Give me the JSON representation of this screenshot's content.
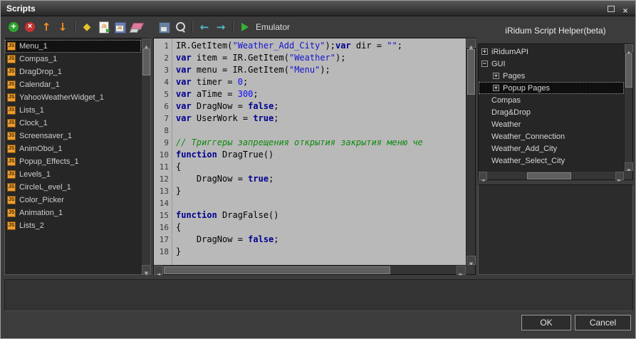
{
  "window": {
    "title": "Scripts",
    "controls": [
      "restore-window-icon",
      "close-window-icon"
    ]
  },
  "toolbar": {
    "script_actions": [
      "add-script-icon",
      "delete-script-icon",
      "move-up-icon",
      "move-down-icon",
      "syntax-check-icon",
      "import-script-icon",
      "save-script-icon",
      "erase-script-icon"
    ],
    "editor_actions": [
      "save-icon",
      "search-icon",
      "back-icon",
      "forward-icon",
      "play-icon"
    ],
    "emulator_label": "Emulator"
  },
  "script_list": {
    "badge_label": "JS",
    "selected_index": 0,
    "items": [
      "Menu_1",
      "Compas_1",
      "DragDrop_1",
      "Calendar_1",
      "YahooWeatherWidget_1",
      "Lists_1",
      "Clock_1",
      "Screensaver_1",
      "AnimOboi_1",
      "Popup_Effects_1",
      "Levels_1",
      "CircleL_evel_1",
      "Color_Picker",
      "Animation_1",
      "Lists_2"
    ]
  },
  "editor": {
    "lines": [
      {
        "n": "1",
        "t": [
          [
            "p",
            "IR.GetItem("
          ],
          [
            "s",
            "\"Weather_Add_City\""
          ],
          [
            "p",
            ");"
          ],
          [
            "k",
            "var"
          ],
          [
            "p",
            " dir = "
          ],
          [
            "s",
            "\"\""
          ],
          [
            "p",
            ";"
          ]
        ]
      },
      {
        "n": "2",
        "t": [
          [
            "k",
            "var"
          ],
          [
            "p",
            " item = IR.GetItem("
          ],
          [
            "s",
            "\"Weather\""
          ],
          [
            "p",
            ");"
          ]
        ]
      },
      {
        "n": "3",
        "t": [
          [
            "k",
            "var"
          ],
          [
            "p",
            " menu = IR.GetItem("
          ],
          [
            "s",
            "\"Menu\""
          ],
          [
            "p",
            ");"
          ]
        ]
      },
      {
        "n": "4",
        "t": [
          [
            "k",
            "var"
          ],
          [
            "p",
            " timer = "
          ],
          [
            "num",
            "0"
          ],
          [
            "p",
            ";"
          ]
        ]
      },
      {
        "n": "5",
        "t": [
          [
            "k",
            "var"
          ],
          [
            "p",
            " aTime = "
          ],
          [
            "num",
            "300"
          ],
          [
            "p",
            ";"
          ]
        ]
      },
      {
        "n": "6",
        "t": [
          [
            "k",
            "var"
          ],
          [
            "p",
            " DragNow = "
          ],
          [
            "k",
            "false"
          ],
          [
            "p",
            ";"
          ]
        ]
      },
      {
        "n": "7",
        "t": [
          [
            "k",
            "var"
          ],
          [
            "p",
            " UserWork = "
          ],
          [
            "k",
            "true"
          ],
          [
            "p",
            ";"
          ]
        ]
      },
      {
        "n": "8",
        "t": []
      },
      {
        "n": "9",
        "t": [
          [
            "c",
            "// Триггеры запрещения открытия закрытия меню че"
          ]
        ]
      },
      {
        "n": "10",
        "t": [
          [
            "k",
            "function"
          ],
          [
            "p",
            " DragTrue()"
          ]
        ]
      },
      {
        "n": "11",
        "t": [
          [
            "p",
            "{"
          ]
        ]
      },
      {
        "n": "12",
        "t": [
          [
            "p",
            "    DragNow = "
          ],
          [
            "k",
            "true"
          ],
          [
            "p",
            ";"
          ]
        ]
      },
      {
        "n": "13",
        "t": [
          [
            "p",
            "}"
          ]
        ]
      },
      {
        "n": "14",
        "t": []
      },
      {
        "n": "15",
        "t": [
          [
            "k",
            "function"
          ],
          [
            "p",
            " DragFalse()"
          ]
        ]
      },
      {
        "n": "16",
        "t": [
          [
            "p",
            "{"
          ]
        ]
      },
      {
        "n": "17",
        "t": [
          [
            "p",
            "    DragNow = "
          ],
          [
            "k",
            "false"
          ],
          [
            "p",
            ";"
          ]
        ]
      },
      {
        "n": "18",
        "t": [
          [
            "p",
            "}"
          ]
        ]
      }
    ]
  },
  "helper": {
    "title": "iRidum Script Helper(beta)",
    "items": [
      {
        "label": "iRidumAPI",
        "level": 0,
        "expander": "plus",
        "selected": false
      },
      {
        "label": "GUI",
        "level": 0,
        "expander": "minus",
        "selected": false
      },
      {
        "label": "Pages",
        "level": 1,
        "expander": "plus",
        "selected": false
      },
      {
        "label": "Popup Pages",
        "level": 1,
        "expander": "plus",
        "selected": true
      },
      {
        "label": "Compas",
        "level": 0,
        "expander": null,
        "selected": false
      },
      {
        "label": "Drag&Drop",
        "level": 0,
        "expander": null,
        "selected": false
      },
      {
        "label": "Weather",
        "level": 0,
        "expander": null,
        "selected": false
      },
      {
        "label": "Weather_Connection",
        "level": 0,
        "expander": null,
        "selected": false
      },
      {
        "label": "Weather_Add_City",
        "level": 0,
        "expander": null,
        "selected": false
      },
      {
        "label": "Weather_Select_City",
        "level": 0,
        "expander": null,
        "selected": false
      }
    ]
  },
  "footer": {
    "ok_label": "OK",
    "cancel_label": "Cancel"
  }
}
